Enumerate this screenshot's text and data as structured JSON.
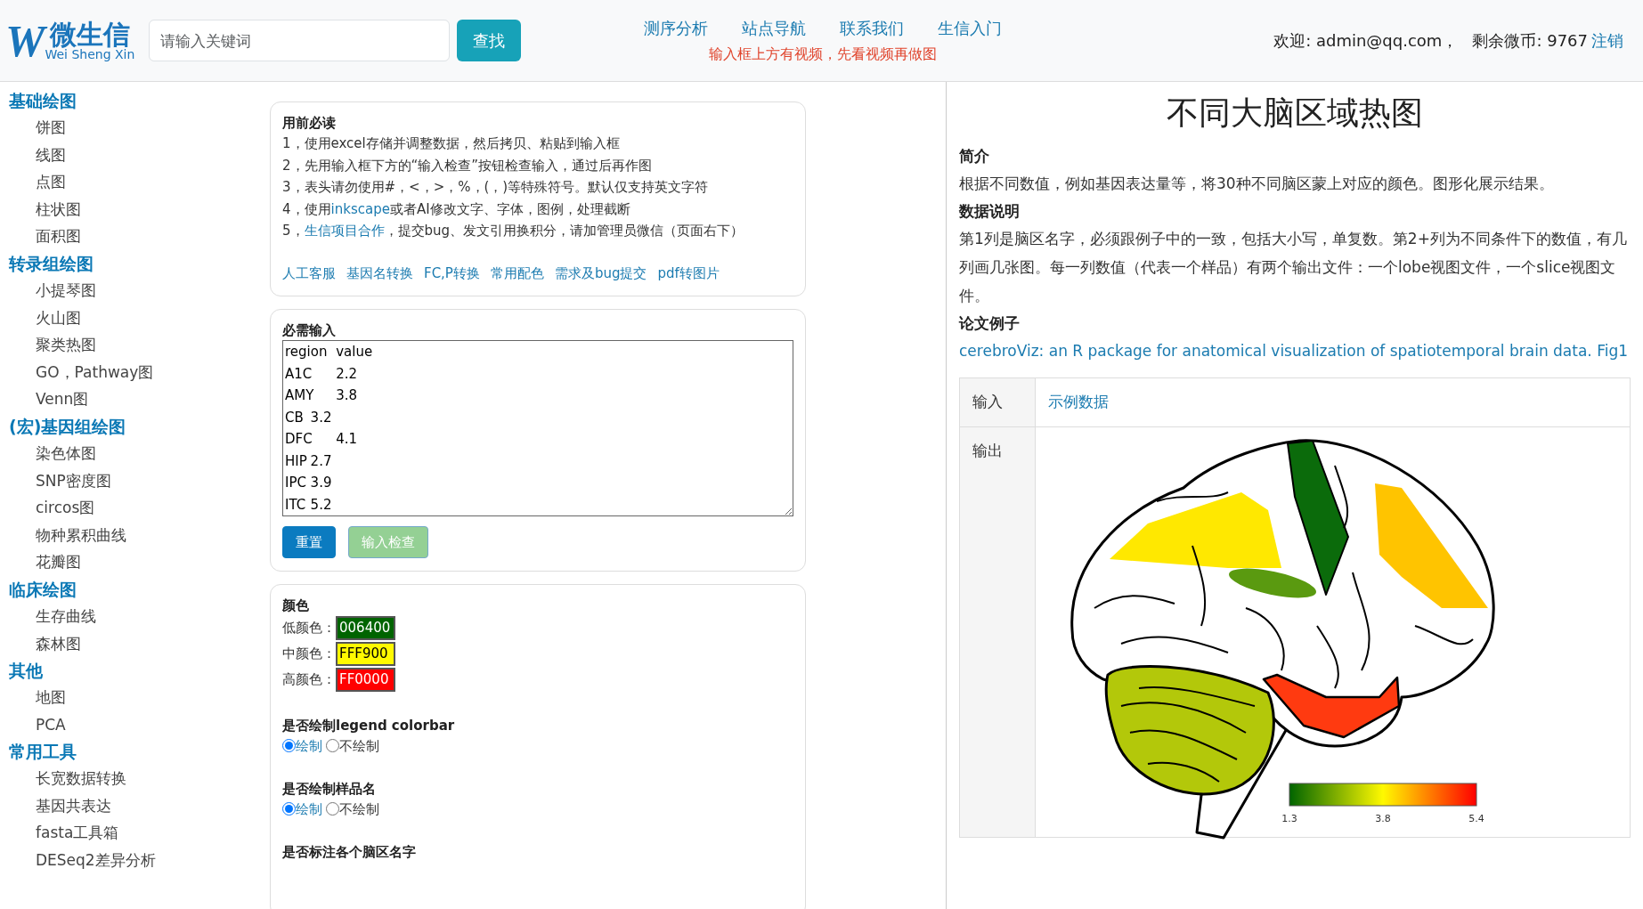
{
  "header": {
    "logo_mark": "W",
    "logo_text": "微生信",
    "logo_subtext": "Wei Sheng Xin",
    "search": {
      "placeholder": "请输入关键词"
    },
    "search_button": "查找",
    "nav": [
      "测序分析",
      "站点导航",
      "联系我们",
      "生信入门"
    ],
    "notice": "输入框上方有视频，先看视频再做图",
    "welcome": "欢迎: admin@qq.com，",
    "coins": "剩余微币: 9767",
    "logout": "注销"
  },
  "sidebar": {
    "groups": [
      {
        "title": "基础绘图",
        "items": [
          "饼图",
          "线图",
          "点图",
          "柱状图",
          "面积图"
        ]
      },
      {
        "title": "转录组绘图",
        "items": [
          "小提琴图",
          "火山图",
          "聚类热图",
          "GO，Pathway图",
          "Venn图"
        ]
      },
      {
        "title": "(宏)基因组绘图",
        "items": [
          "染色体图",
          "SNP密度图",
          "circos图",
          "物种累积曲线",
          "花瓣图"
        ]
      },
      {
        "title": "临床绘图",
        "items": [
          "生存曲线",
          "森林图"
        ]
      },
      {
        "title": "其他",
        "items": [
          "地图",
          "PCA"
        ]
      },
      {
        "title": "常用工具",
        "items": [
          "长宽数据转换",
          "基因共表达",
          "fasta工具箱",
          "DESeq2差异分析"
        ]
      }
    ]
  },
  "guide": {
    "title": "用前必读",
    "lines": [
      {
        "parts": [
          {
            "text": "1，使用excel存储并调整数据，然后拷贝、粘贴到输入框",
            "link": false
          }
        ]
      },
      {
        "parts": [
          {
            "text": "2，先用输入框下方的“输入检查”按钮检查输入，通过后再作图",
            "link": false
          }
        ]
      },
      {
        "parts": [
          {
            "text": "3，表头请勿使用#，<，>，%，(，)等特殊符号。默认仅支持英文字符",
            "link": false
          }
        ]
      },
      {
        "parts": [
          {
            "text": "4，使用",
            "link": false
          },
          {
            "text": "inkscape",
            "link": true
          },
          {
            "text": "或者AI修改文字、字体，图例，处理截断",
            "link": false
          }
        ]
      },
      {
        "parts": [
          {
            "text": "5，",
            "link": false
          },
          {
            "text": "生信项目合作",
            "link": true
          },
          {
            "text": "，提交bug、发文引用换积分，请加管理员微信（页面右下）",
            "link": false
          }
        ]
      }
    ],
    "links": [
      "人工客服",
      "基因名转换",
      "FC,P转换",
      "常用配色",
      "需求及bug提交",
      "pdf转图片"
    ]
  },
  "input": {
    "title": "必需输入",
    "value": "region\tvalue\nA1C\t2.2\nAMY\t3.8\nCB\t3.2\nDFC\t4.1\nHIP\t2.7\nIPC\t3.9\nITC\t5.2",
    "buttons": [
      {
        "label": "重置",
        "kind": "primary",
        "disabled": false
      },
      {
        "label": "输入检查",
        "kind": "success",
        "disabled": true
      }
    ]
  },
  "options": {
    "color_title": "颜色",
    "colors": [
      {
        "label": "低颜色：",
        "value": "006400"
      },
      {
        "label": "中颜色：",
        "value": "FFF900"
      },
      {
        "label": "高颜色：",
        "value": "FF0000"
      }
    ],
    "questions": [
      {
        "title": "是否绘制legend colorbar",
        "choices": [
          {
            "label": "绘制",
            "selected": true
          },
          {
            "label": "不绘制",
            "selected": false
          }
        ]
      },
      {
        "title": "是否绘制样品名",
        "choices": [
          {
            "label": "绘制",
            "selected": true
          },
          {
            "label": "不绘制",
            "selected": false
          }
        ]
      },
      {
        "title": "是否标注各个脑区名字"
      }
    ]
  },
  "detail": {
    "title": "不同大脑区域热图",
    "sections": [
      {
        "heading": "简介",
        "text": "根据不同数值，例如基因表达量等，将30种不同脑区蒙上对应的颜色。图形化展示结果。"
      },
      {
        "heading": "数据说明",
        "text": "第1列是脑区名字，必须跟例子中的一致，包括大小写，单复数。第2+列为不同条件下的数值，有几列画几张图。每一列数值（代表一个样品）有两个输出文件：一个lobe视图文件，一个slice视图文件。"
      },
      {
        "heading": "论文例子",
        "link": "cerebroViz: an R package for anatomical visualization of spatiotemporal brain data. Fig1"
      }
    ],
    "input_label": "输入",
    "input_link": "示例数据",
    "output_label": "输出",
    "colorbar_ticks": [
      "1.3",
      "3.8",
      "5.4"
    ]
  }
}
